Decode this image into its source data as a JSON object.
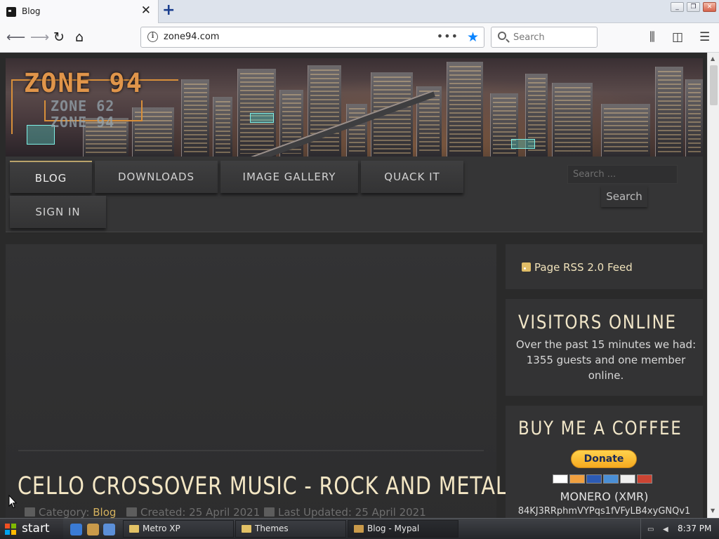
{
  "browser": {
    "tab_title": "Blog",
    "close_glyph": "✕",
    "new_tab_glyph": "+",
    "url": "zone94.com",
    "page_actions_glyph": "•••",
    "search_placeholder": "Search",
    "bookmark_color": "#0a84ff"
  },
  "site": {
    "logo_main": "ZONE 94",
    "logo_sub_1": "ZONE 62",
    "logo_sub_2": "ZONE 94",
    "menu": [
      {
        "label": "BLOG",
        "active": true
      },
      {
        "label": "DOWNLOADS",
        "active": false
      },
      {
        "label": "IMAGE GALLERY",
        "active": false
      },
      {
        "label": "QUACK IT",
        "active": false
      },
      {
        "label": "SIGN IN",
        "active": false
      }
    ],
    "search_placeholder": "Search ...",
    "search_button": "Search",
    "accent_color": "#d4b15e"
  },
  "article": {
    "title": "CELLO CROSSOVER MUSIC - ROCK AND METAL",
    "category_label": "Category:",
    "category_value": "Blog",
    "created": "Created: 25 April 2021",
    "updated": "Last Updated: 25 April 2021"
  },
  "sidebar": {
    "rss_label": "Page RSS 2.0 Feed",
    "visitors_title": "VISITORS ONLINE",
    "visitors_text": "Over the past 15 minutes we had: 1355 guests and one member online.",
    "coffee_title": "BUY ME A COFFEE",
    "donate_label": "Donate",
    "monero_title": "MONERO (XMR)",
    "monero_address": "84KJ3RRphmVYPqs1fVFyLB4xyGNQv1"
  },
  "taskbar": {
    "start_label": "start",
    "tasks": [
      {
        "label": "Metro XP"
      },
      {
        "label": "Themes"
      },
      {
        "label": "Blog - Mypal"
      }
    ],
    "clock": "8:37 PM"
  }
}
